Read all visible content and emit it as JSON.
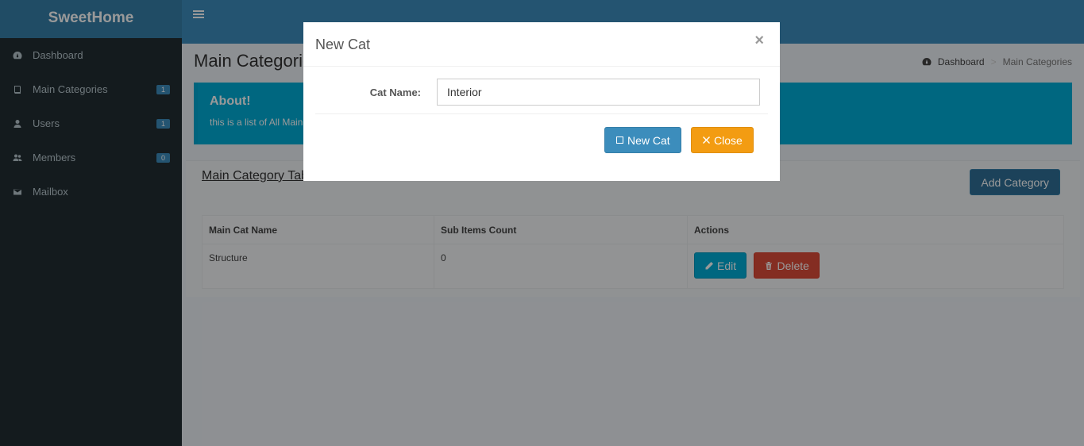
{
  "brand": "SweetHome",
  "sidebar": {
    "items": [
      {
        "label": "Dashboard",
        "icon": "dashboard-icon",
        "badge": null
      },
      {
        "label": "Main Categories",
        "icon": "book-icon",
        "badge": "1"
      },
      {
        "label": "Users",
        "icon": "user-icon",
        "badge": "1"
      },
      {
        "label": "Members",
        "icon": "users-icon",
        "badge": "0"
      },
      {
        "label": "Mailbox",
        "icon": "envelope-icon",
        "badge": null
      }
    ]
  },
  "page": {
    "title": "Main Categories",
    "breadcrumb": {
      "home": "Dashboard",
      "separator": ">",
      "current": "Main Categories"
    }
  },
  "callout": {
    "heading": "About!",
    "text": "this is a list of All Main Categories"
  },
  "box": {
    "title": "Main Category Table",
    "add_button": "Add Category"
  },
  "table": {
    "headers": [
      "Main Cat Name",
      "Sub Items Count",
      "Actions"
    ],
    "rows": [
      {
        "name": "Structure",
        "count": "0",
        "edit": "Edit",
        "delete": "Delete"
      }
    ]
  },
  "modal": {
    "title": "New Cat",
    "close_symbol": "×",
    "field_label": "Cat Name:",
    "field_value": "Interior",
    "submit_label": "New Cat",
    "close_label": "Close"
  },
  "colors": {
    "primary": "#3c8dbc",
    "sidebar": "#222d32",
    "info": "#00acd6",
    "danger": "#dd4b39",
    "warning": "#f39c12"
  }
}
